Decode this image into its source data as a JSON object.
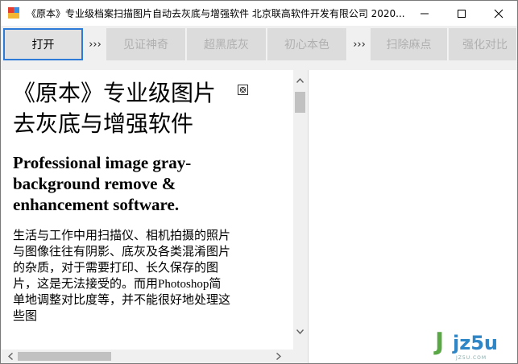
{
  "window": {
    "title": "《原本》专业级档案扫描图片自动去灰底与增强软件 北京联高软件开发有限公司 2020..."
  },
  "title_bar": {
    "app_icon": "app-icon",
    "minimize_icon": "minimize-icon",
    "maximize_icon": "maximize-icon",
    "close_icon": "close-icon"
  },
  "toolbar": {
    "open_label": "打开",
    "sep1": "›››",
    "btn_witness": "见证神奇",
    "btn_super_black": "超黑底灰",
    "btn_original_color": "初心本色",
    "sep2": "›››",
    "btn_remove_spots": "扫除麻点",
    "btn_enhance_contrast": "强化对比"
  },
  "document": {
    "title": "《原本》专业级图片去灰底与增强软件",
    "subtitle": "Professional image gray-background remove & enhancement software.",
    "body": "生活与工作中用扫描仪、相机拍摄的照片与图像往往有阴影、底灰及各类混淆图片的杂质，对于需要打印、长久保存的图片，这是无法接受的。而用Photoshop简单地调整对比度等，并不能很好地处理这些图"
  },
  "watermark": {
    "brand_j": "J",
    "brand_rest": "jz5u",
    "sub": "JZ5U.COM"
  },
  "colors": {
    "open_button_border": "#2d7bd6",
    "disabled_text": "#b0b0b0",
    "watermark_green": "#5aa845",
    "watermark_blue": "#2f86c6"
  }
}
